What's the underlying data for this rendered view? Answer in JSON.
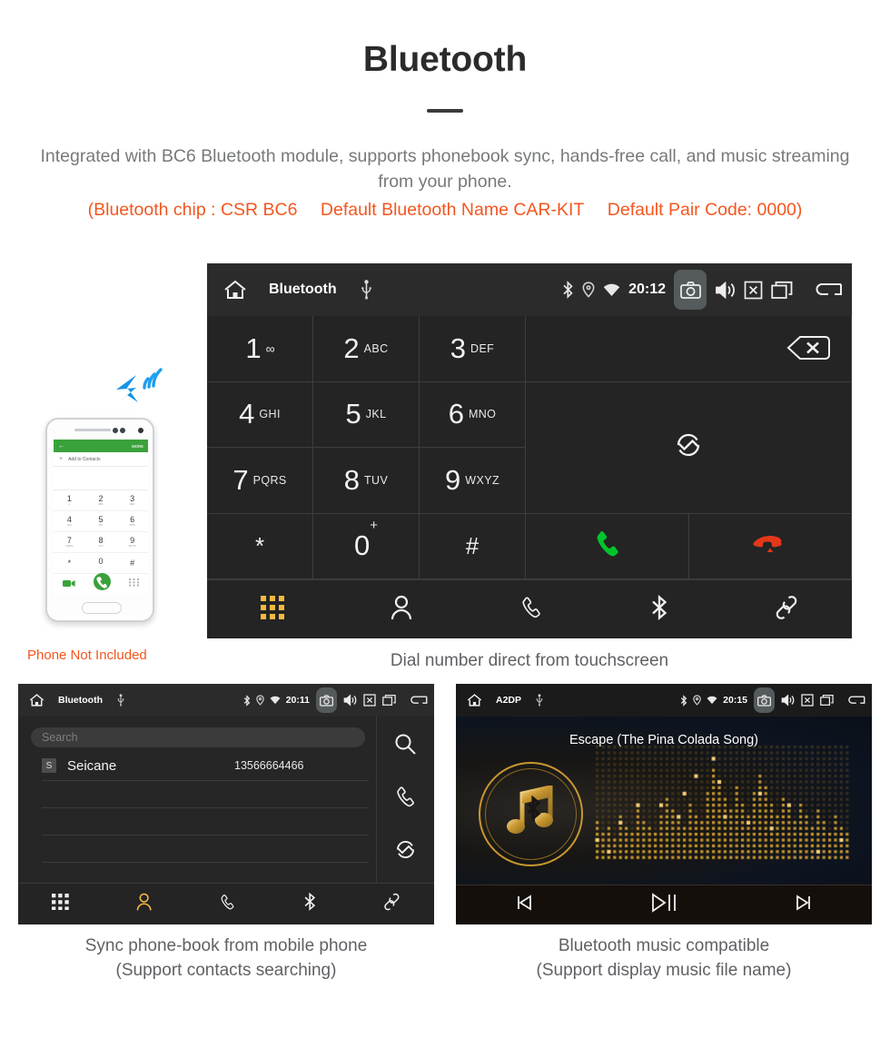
{
  "header": {
    "title": "Bluetooth",
    "subtitle": "Integrated with BC6 Bluetooth module, supports phonebook sync, hands-free call, and music streaming from your phone.",
    "spec_chip": "(Bluetooth chip : CSR BC6",
    "spec_name": "Default Bluetooth Name CAR-KIT",
    "spec_pair": "Default Pair Code: 0000)"
  },
  "main_screen": {
    "statusbar": {
      "home_icon": "home-icon",
      "title": "Bluetooth",
      "usb_icon": "usb-icon",
      "bluetooth_icon": "bluetooth-icon",
      "location_icon": "location-icon",
      "wifi_icon": "wifi-icon",
      "clock": "20:12",
      "camera_icon": "camera-icon",
      "volume_icon": "volume-icon",
      "close_icon": "close-box-icon",
      "recents_icon": "recents-icon",
      "back_icon": "back-icon"
    },
    "keys": [
      {
        "num": "1",
        "sub": "∞",
        "type": "voicemail"
      },
      {
        "num": "2",
        "sub": "ABC"
      },
      {
        "num": "3",
        "sub": "DEF"
      },
      {
        "num": "4",
        "sub": "GHI"
      },
      {
        "num": "5",
        "sub": "JKL"
      },
      {
        "num": "6",
        "sub": "MNO"
      },
      {
        "num": "7",
        "sub": "PQRS"
      },
      {
        "num": "8",
        "sub": "TUV"
      },
      {
        "num": "9",
        "sub": "WXYZ"
      },
      {
        "num": "*",
        "sub": ""
      },
      {
        "num": "0",
        "sup": "+"
      },
      {
        "num": "#",
        "sub": ""
      }
    ],
    "actions": {
      "backspace_icon": "backspace-icon",
      "sync_icon": "sync-icon",
      "call_icon": "call-answer-icon",
      "hangup_icon": "call-end-icon",
      "call_color": "#00c32c",
      "hangup_color": "#e5371a"
    },
    "tabbar": [
      {
        "name": "dialpad",
        "icon": "dialpad-icon",
        "active": true
      },
      {
        "name": "contacts",
        "icon": "person-icon",
        "active": false
      },
      {
        "name": "call-log",
        "icon": "phone-handset-icon",
        "active": false
      },
      {
        "name": "bluetooth",
        "icon": "bluetooth-icon",
        "active": false
      },
      {
        "name": "pair-link",
        "icon": "link-icon",
        "active": false
      }
    ],
    "active_color": "#f5b942",
    "caption": "Dial number direct from touchscreen"
  },
  "phone_mockup": {
    "appbar_back": "←",
    "appbar_more": "MORE",
    "add_contact_plus": "+",
    "add_contact_label": "Add to Contacts",
    "keys": [
      {
        "num": "1",
        "sub": "∞"
      },
      {
        "num": "2",
        "sub": "ABC"
      },
      {
        "num": "3",
        "sub": "DEF"
      },
      {
        "num": "4",
        "sub": "GHI"
      },
      {
        "num": "5",
        "sub": "JKL"
      },
      {
        "num": "6",
        "sub": "MNO"
      },
      {
        "num": "7",
        "sub": "PQRS"
      },
      {
        "num": "8",
        "sub": "TUV"
      },
      {
        "num": "9",
        "sub": "WXYZ"
      },
      {
        "num": "*",
        "sub": ""
      },
      {
        "num": "0",
        "sub": "+"
      },
      {
        "num": "#",
        "sub": ""
      }
    ],
    "video_icon": "video-call-icon",
    "call_icon": "call-answer-icon",
    "keyboard_icon": "keyboard-icon",
    "bluetooth_signal_icon": "bluetooth-signal-icon",
    "bluetooth_color": "#1593e8",
    "not_included_label": "Phone Not Included"
  },
  "phonebook_screen": {
    "statusbar": {
      "home_icon": "home-icon",
      "title": "Bluetooth",
      "usb_icon": "usb-icon",
      "clock": "20:11",
      "camera_icon": "camera-icon",
      "volume_icon": "volume-icon",
      "close_icon": "close-box-icon",
      "recents_icon": "recents-icon",
      "back_icon": "back-icon"
    },
    "search_placeholder": "Search",
    "columns": [
      "name",
      "number"
    ],
    "contacts": [
      {
        "initial": "S",
        "name": "Seicane",
        "number": "13566664466"
      }
    ],
    "side_actions": [
      {
        "name": "search",
        "icon": "search-icon"
      },
      {
        "name": "call",
        "icon": "phone-handset-icon"
      },
      {
        "name": "sync",
        "icon": "sync-icon"
      }
    ],
    "tabbar": [
      {
        "name": "dialpad",
        "icon": "dialpad-icon",
        "active": false
      },
      {
        "name": "contacts",
        "icon": "person-icon",
        "active": true
      },
      {
        "name": "call-log",
        "icon": "phone-handset-icon",
        "active": false
      },
      {
        "name": "bluetooth",
        "icon": "bluetooth-icon",
        "active": false
      },
      {
        "name": "pair-link",
        "icon": "link-icon",
        "active": false
      }
    ],
    "caption_line1": "Sync phone-book from mobile phone",
    "caption_line2": "(Support contacts searching)"
  },
  "music_screen": {
    "statusbar": {
      "home_icon": "home-icon",
      "title": "A2DP",
      "usb_icon": "usb-icon",
      "clock": "20:15",
      "camera_icon": "camera-icon",
      "volume_icon": "volume-icon",
      "close_icon": "close-box-icon",
      "recents_icon": "recents-icon",
      "back_icon": "back-icon"
    },
    "song_title": "Escape (The Pina Colada Song)",
    "album_art_icon": "music-note-bluetooth-icon",
    "visualizer": "dot-matrix-equalizer",
    "controls": [
      {
        "name": "previous",
        "icon": "skip-previous-icon"
      },
      {
        "name": "play-pause",
        "icon": "play-pause-icon"
      },
      {
        "name": "next",
        "icon": "skip-next-icon"
      }
    ],
    "gold_color": "#c9972f",
    "caption_line1": "Bluetooth music compatible",
    "caption_line2": "(Support display music file name)"
  }
}
